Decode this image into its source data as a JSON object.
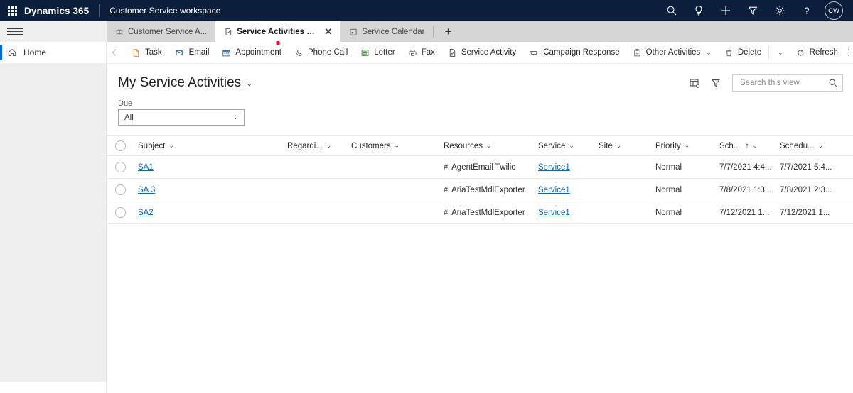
{
  "appbar": {
    "waffle_icon": "app-launcher-icon",
    "brand": "Dynamics 365",
    "app_name": "Customer Service workspace",
    "icons": [
      {
        "name": "search-icon",
        "glyph": "search"
      },
      {
        "name": "lightbulb-icon",
        "glyph": "bulb"
      },
      {
        "name": "quick-create-icon",
        "glyph": "plus"
      },
      {
        "name": "filter-icon",
        "glyph": "funnel"
      },
      {
        "name": "settings-gear-icon",
        "glyph": "gear"
      },
      {
        "name": "help-icon",
        "glyph": "question"
      }
    ],
    "avatar_initials": "CW"
  },
  "tabs": {
    "items": [
      {
        "label": "Customer Service A...",
        "icon": "sitemap-icon",
        "active": false,
        "closable": false
      },
      {
        "label": "Service Activities My Ser...",
        "icon": "service-activity-icon",
        "active": true,
        "closable": true
      },
      {
        "label": "Service Calendar",
        "icon": "calendar-icon",
        "active": false,
        "closable": false
      }
    ],
    "new_tab_label": "+",
    "close_label": "✕"
  },
  "sidebar": {
    "items": [
      {
        "label": "Home",
        "icon": "home-icon",
        "selected": true
      }
    ]
  },
  "commandbar": {
    "back_label": "←",
    "items": [
      {
        "label": "Task",
        "icon": "task-icon",
        "chevron": false
      },
      {
        "label": "Email",
        "icon": "email-icon",
        "chevron": false
      },
      {
        "label": "Appointment",
        "icon": "appointment-icon",
        "chevron": false
      },
      {
        "label": "Phone Call",
        "icon": "phone-icon",
        "chevron": false
      },
      {
        "label": "Letter",
        "icon": "letter-icon",
        "chevron": false
      },
      {
        "label": "Fax",
        "icon": "fax-icon",
        "chevron": false
      },
      {
        "label": "Service Activity",
        "icon": "service-activity-icon",
        "chevron": false
      },
      {
        "label": "Campaign Response",
        "icon": "campaign-response-icon",
        "chevron": false
      },
      {
        "label": "Other Activities",
        "icon": "other-activities-icon",
        "chevron": true
      },
      {
        "label": "Delete",
        "icon": "trash-icon",
        "chevron": true
      },
      {
        "label": "Refresh",
        "icon": "refresh-icon",
        "chevron": false
      }
    ],
    "overflow_label": "⋮",
    "chevron": "⌄"
  },
  "view": {
    "title": "My Service Activities",
    "title_chevron": "⌄",
    "edit_columns_icon": "edit-columns-icon",
    "filter_icon": "filter-icon",
    "search_placeholder": "Search this view",
    "search_value": "",
    "search_icon": "search-icon"
  },
  "due_filter": {
    "label": "Due",
    "value": "All",
    "chevron": "⌄"
  },
  "grid": {
    "columns": [
      {
        "key": "subject",
        "label": "Subject",
        "chevron": true,
        "sorted": false
      },
      {
        "key": "regarding",
        "label": "Regardi...",
        "chevron": true,
        "sorted": false
      },
      {
        "key": "customers",
        "label": "Customers",
        "chevron": true,
        "sorted": false
      },
      {
        "key": "resources",
        "label": "Resources",
        "chevron": true,
        "sorted": false
      },
      {
        "key": "service",
        "label": "Service",
        "chevron": true,
        "sorted": false
      },
      {
        "key": "site",
        "label": "Site",
        "chevron": true,
        "sorted": false
      },
      {
        "key": "priority",
        "label": "Priority",
        "chevron": true,
        "sorted": false
      },
      {
        "key": "sch",
        "label": "Sch...",
        "chevron": true,
        "sorted": true,
        "sort_arrow": "↑"
      },
      {
        "key": "schedu",
        "label": "Schedu...",
        "chevron": true,
        "sorted": false
      }
    ],
    "rows": [
      {
        "subject": "SA1",
        "regarding": "",
        "customers": "",
        "resources": "AgentEmail Twilio",
        "resource_prefix": "#",
        "service": "Service1",
        "site": "",
        "priority": "Normal",
        "sch": "7/7/2021 4:4...",
        "schedu": "7/7/2021 5:4..."
      },
      {
        "subject": "SA 3",
        "regarding": "",
        "customers": "",
        "resources": "AriaTestMdlExporter",
        "resource_prefix": "#",
        "service": "Service1",
        "site": "",
        "priority": "Normal",
        "sch": "7/8/2021 1:3...",
        "schedu": "7/8/2021 2:3..."
      },
      {
        "subject": "SA2",
        "regarding": "",
        "customers": "",
        "resources": "AriaTestMdlExporter",
        "resource_prefix": "#",
        "service": "Service1",
        "site": "",
        "priority": "Normal",
        "sch": "7/12/2021 1...",
        "schedu": "7/12/2021 1..."
      }
    ],
    "header_chevron": "⌄"
  },
  "colors": {
    "appbar_bg": "#0b1f3d",
    "tabstrip_bg": "#d6d6d6",
    "link": "#1264a3",
    "accent": "#0b63ce",
    "tab_dot": "#e81123"
  }
}
